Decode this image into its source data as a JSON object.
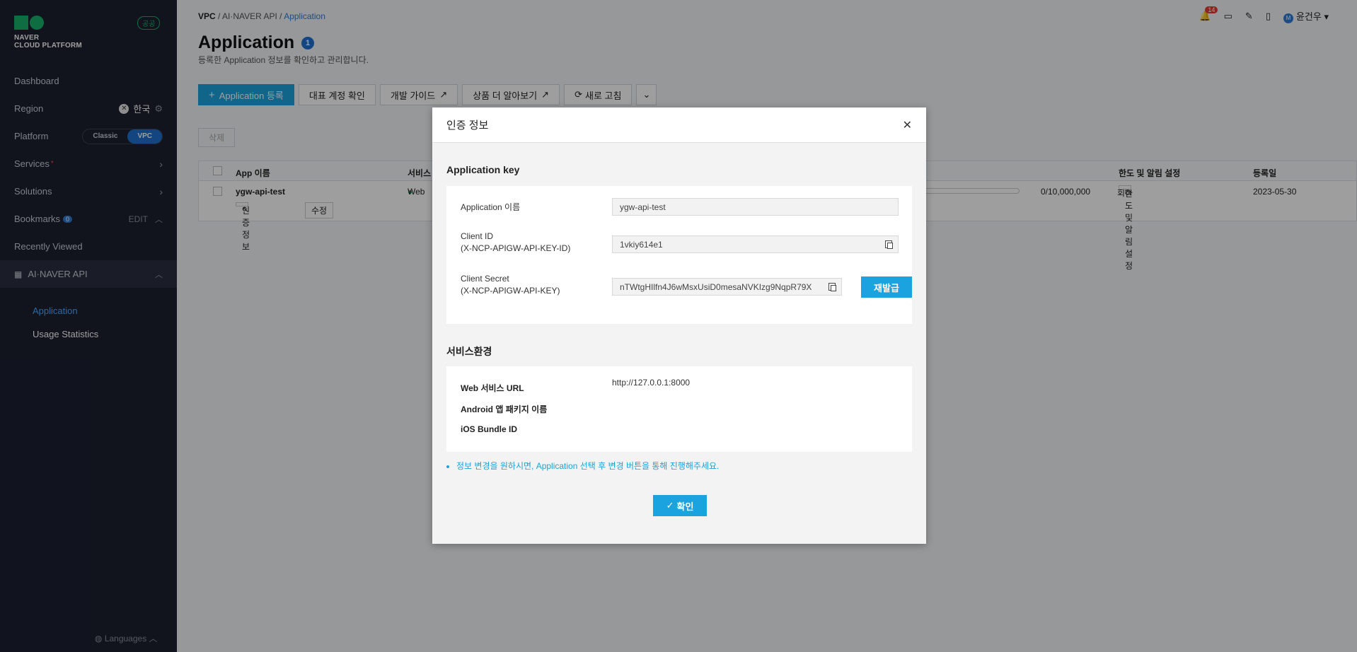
{
  "sidebar": {
    "logo_line1": "NAVER",
    "logo_line2": "CLOUD PLATFORM",
    "public_badge": "공공",
    "dashboard": "Dashboard",
    "region_label": "Region",
    "region_value": "한국",
    "platform_label": "Platform",
    "platform_classic": "Classic",
    "platform_vpc": "VPC",
    "services": "Services",
    "solutions": "Solutions",
    "bookmarks": "Bookmarks",
    "bookmarks_count": "0",
    "bookmarks_edit": "EDIT",
    "recently_viewed": "Recently Viewed",
    "recent_item": "AI·NAVER API",
    "sub_items": [
      "Application",
      "Usage Statistics"
    ],
    "languages": "Languages"
  },
  "header": {
    "breadcrumb": [
      "VPC",
      "AI·NAVER API",
      "Application"
    ],
    "title": "Application",
    "title_count": "1",
    "description": "등록한 Application 정보를 확인하고 관리합니다.",
    "notification_count": "14",
    "user_initial": "M",
    "user_name": "윤건우"
  },
  "toolbar": {
    "register": "Application 등록",
    "account_check": "대표 계정 확인",
    "dev_guide": "개발 가이드",
    "learn_more": "상품 더 알아보기",
    "refresh": "새로 고침"
  },
  "table": {
    "delete": "삭제",
    "headers": [
      "App 이름",
      "서비스",
      "한도 및 알림 설정",
      "등록일"
    ],
    "row": {
      "app_name": "ygw-api-test",
      "auth_info": "인증 정보",
      "edit": "수정",
      "service": "Web",
      "usage": "0/10,000,000",
      "usage_unit": "회",
      "limit_setting": "한도 및 알림 설정",
      "date": "2023-05-30"
    }
  },
  "modal": {
    "title": "인증 정보",
    "section_key": "Application key",
    "app_name_label": "Application 이름",
    "app_name_value": "ygw-api-test",
    "client_id_label": "Client ID",
    "client_id_header": "(X-NCP-APIGW-API-KEY-ID)",
    "client_id_value": "1vkiy614e1",
    "client_secret_label": "Client Secret",
    "client_secret_header": "(X-NCP-APIGW-API-KEY)",
    "client_secret_value": "nTWtgHIlfn4J6wMsxUsiD0mesaNVKIzg9NqpR79X",
    "reissue": "재발급",
    "section_env": "서비스환경",
    "web_url_label": "Web 서비스 URL",
    "web_url_value": "http://127.0.0.1:8000",
    "android_label": "Android 앱 패키지 이름",
    "ios_label": "iOS Bundle ID",
    "note": "정보 변경을 원하시면, Application 선택 후 변경 버튼을 통해 진행해주세요.",
    "confirm": "확인"
  },
  "colors": {
    "accent": "#1aa3de",
    "sidebar_bg": "#1c2130",
    "brand_green": "#18b26b"
  }
}
